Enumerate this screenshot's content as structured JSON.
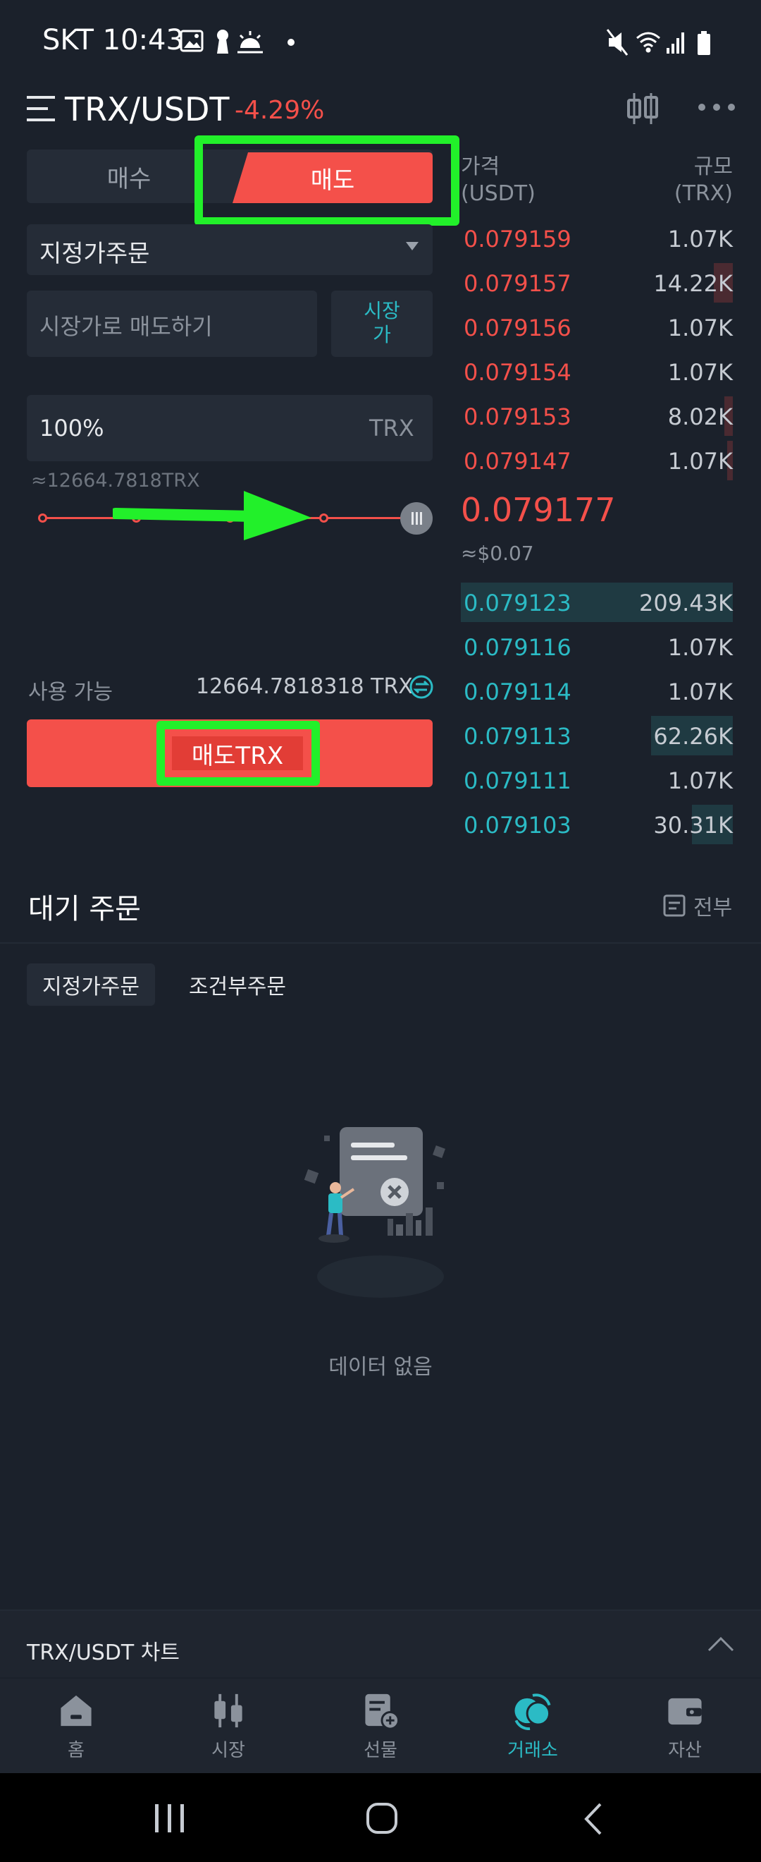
{
  "status_bar": {
    "carrier_time": "SKT 10:43",
    "left_icons": [
      "gallery-icon",
      "keyhole-icon",
      "weather-icon",
      "dot-icon"
    ],
    "right_icons": [
      "mute-icon",
      "wifi-icon",
      "signal-icon",
      "battery-icon"
    ]
  },
  "header": {
    "pair": "TRX/USDT",
    "change": "-4.29%",
    "menu_icon": "menu-icon",
    "chart_icon": "candlestick-icon",
    "more_icon": "more-icon"
  },
  "trade": {
    "buy_tab": "매수",
    "sell_tab": "매도",
    "order_type": "지정가주문",
    "price_placeholder": "시장가로 매도하기",
    "market_button": "시장가",
    "quantity": "100%",
    "quantity_unit": "TRX",
    "quantity_approx": "≈12664.7818TRX",
    "slider_percent": 100,
    "available_label": "사용 가능",
    "available_value": "12664.7818318 TRX",
    "submit_label": "매도TRX"
  },
  "order_book": {
    "price_header": "가격\n(USDT)",
    "size_header": "규모\n(TRX)",
    "asks": [
      {
        "price": "0.079159",
        "size": "1.07K",
        "depth": 0.0
      },
      {
        "price": "0.079157",
        "size": "14.22K",
        "depth": 0.07
      },
      {
        "price": "0.079156",
        "size": "1.07K",
        "depth": 0.0
      },
      {
        "price": "0.079154",
        "size": "1.07K",
        "depth": 0.0
      },
      {
        "price": "0.079153",
        "size": "8.02K",
        "depth": 0.03
      },
      {
        "price": "0.079147",
        "size": "1.07K",
        "depth": 0.02
      }
    ],
    "last_price": "0.079177",
    "last_price_usd": "≈$0.07",
    "bids": [
      {
        "price": "0.079123",
        "size": "209.43K",
        "depth": 1.0
      },
      {
        "price": "0.079116",
        "size": "1.07K",
        "depth": 0.0
      },
      {
        "price": "0.079114",
        "size": "1.07K",
        "depth": 0.0
      },
      {
        "price": "0.079113",
        "size": "62.26K",
        "depth": 0.3
      },
      {
        "price": "0.079111",
        "size": "1.07K",
        "depth": 0.0
      },
      {
        "price": "0.079103",
        "size": "30.31K",
        "depth": 0.15
      }
    ]
  },
  "pending": {
    "title": "대기 주문",
    "all_label": "전부",
    "tab_limit": "지정가주문",
    "tab_conditional": "조건부주문",
    "empty_text": "데이터 없음"
  },
  "chart_bar": {
    "label": "TRX/USDT 차트"
  },
  "bottom_nav": [
    {
      "label": "홈",
      "icon": "home-icon",
      "active": false
    },
    {
      "label": "시장",
      "icon": "market-icon",
      "active": false
    },
    {
      "label": "선물",
      "icon": "futures-icon",
      "active": false
    },
    {
      "label": "거래소",
      "icon": "exchange-icon",
      "active": true
    },
    {
      "label": "자산",
      "icon": "wallet-icon",
      "active": false
    }
  ],
  "colors": {
    "sell": "#f4504a",
    "buy": "#2bbbc5",
    "highlight": "#22f02a",
    "background": "#1b212b"
  }
}
